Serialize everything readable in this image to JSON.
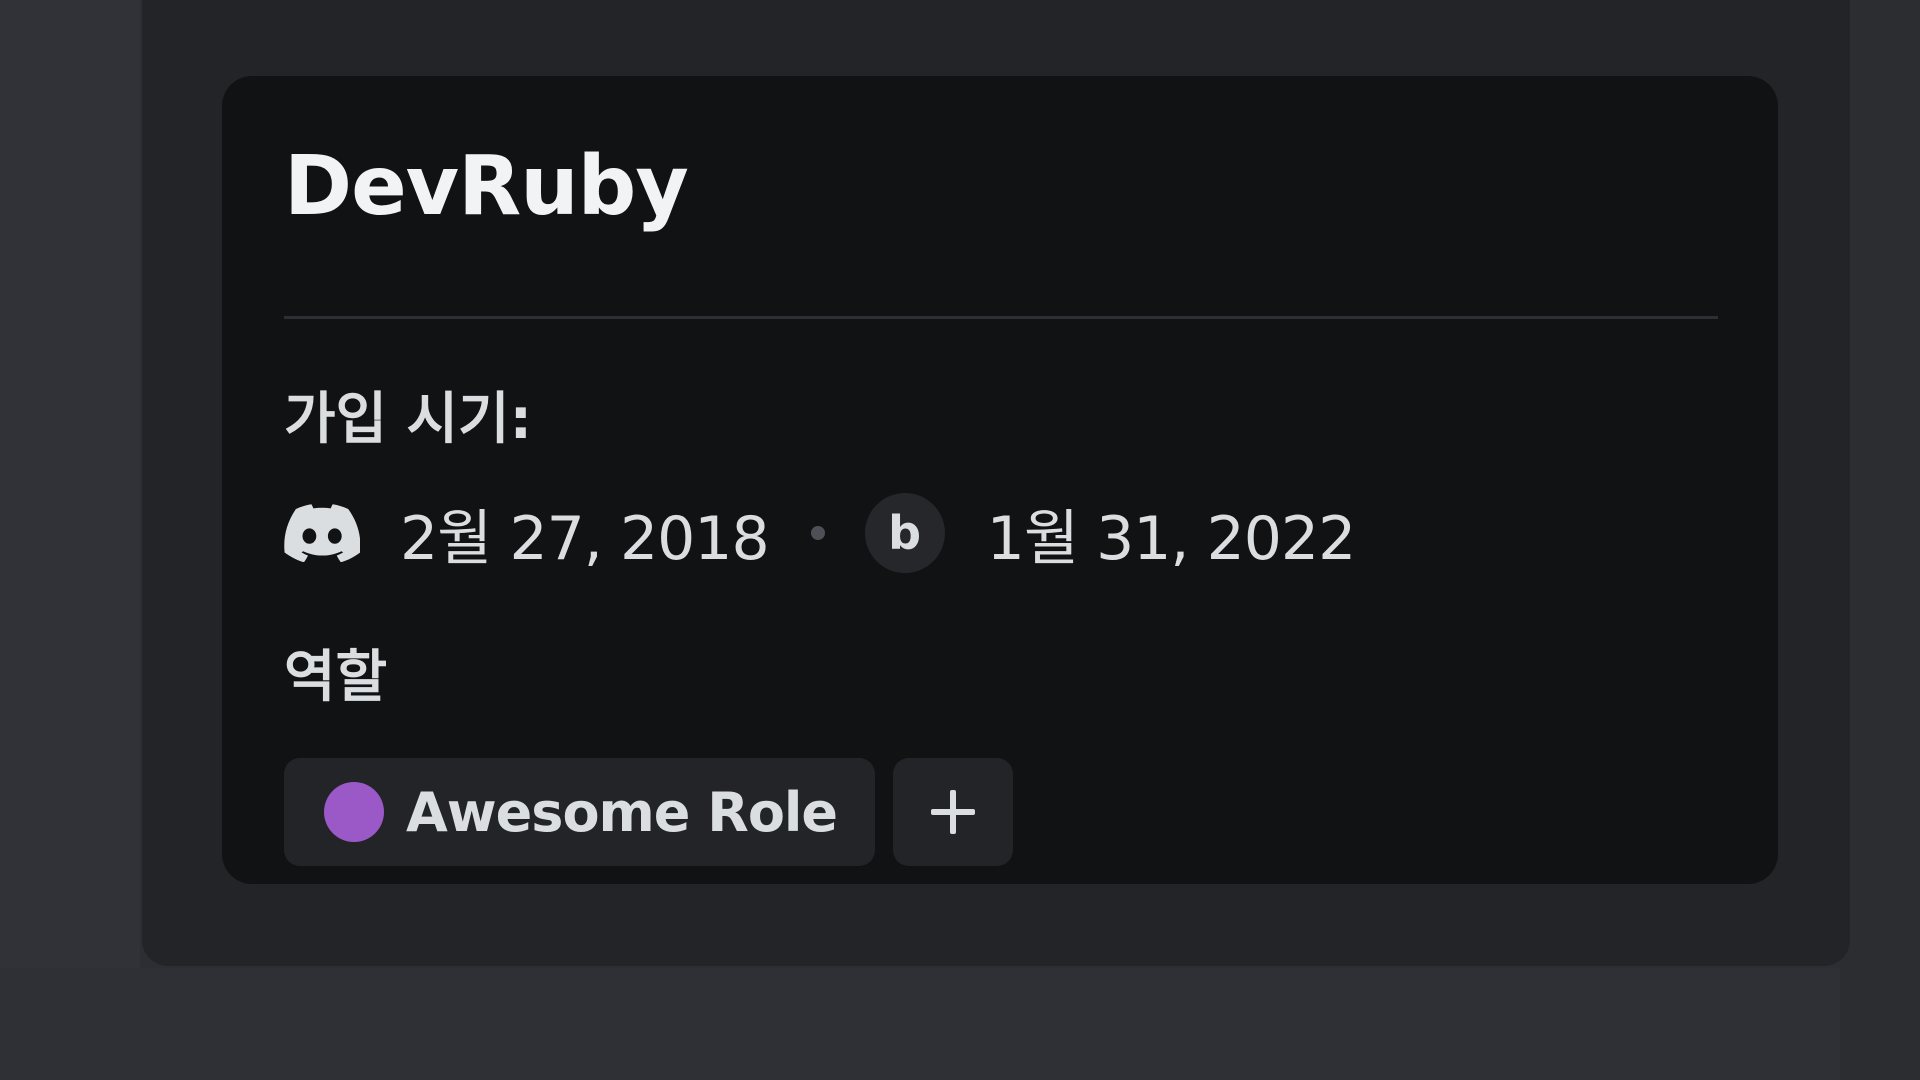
{
  "profile": {
    "username": "DevRuby"
  },
  "member_since": {
    "heading": "가입 시기:",
    "discord_date": "2월 27, 2018",
    "server_icon_letter": "b",
    "server_date": "1월 31, 2022"
  },
  "roles": {
    "heading": "역할",
    "items": [
      {
        "name": "Awesome Role",
        "color": "#9b59c8"
      }
    ]
  },
  "icons": {
    "discord": "discord-logo-icon",
    "add": "plus-icon"
  },
  "colors": {
    "card_background": "#111214",
    "panel_background": "#232428",
    "text_primary": "#f2f3f5",
    "text_secondary": "#dbdee1"
  }
}
